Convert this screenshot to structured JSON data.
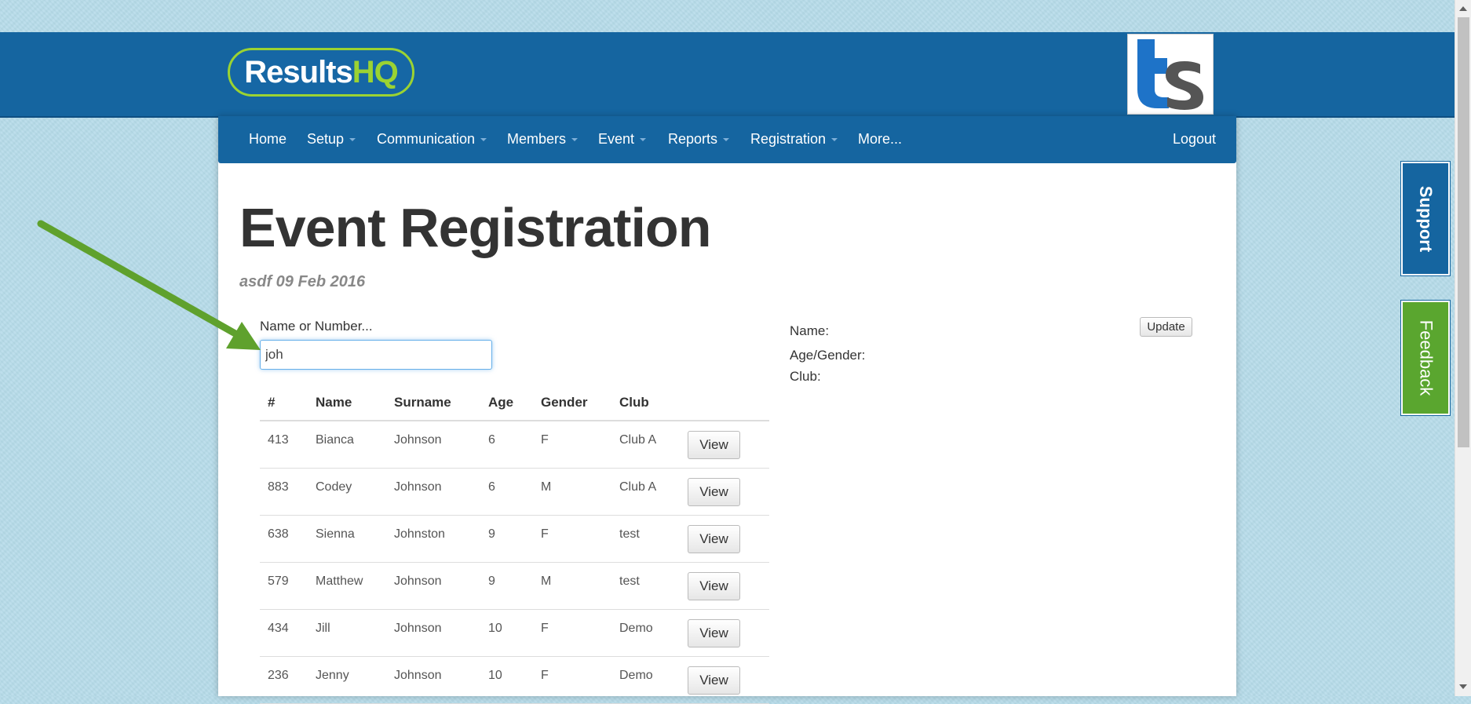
{
  "header": {
    "logo_main": "Results",
    "logo_accent": "HQ",
    "brand_color": "#1565a0",
    "accent_color": "#9bd332"
  },
  "nav": {
    "home": "Home",
    "setup": "Setup",
    "communication": "Communication",
    "members": "Members",
    "event": "Event",
    "reports": "Reports",
    "registration": "Registration",
    "more": "More...",
    "logout": "Logout"
  },
  "page": {
    "title": "Event Registration",
    "subtitle": "asdf 09 Feb 2016"
  },
  "search": {
    "label": "Name or Number...",
    "value": "joh"
  },
  "table": {
    "headers": [
      "#",
      "Name",
      "Surname",
      "Age",
      "Gender",
      "Club"
    ],
    "view_label": "View",
    "rows": [
      [
        "413",
        "Bianca",
        "Johnson",
        "6",
        "F",
        "Club A"
      ],
      [
        "883",
        "Codey",
        "Johnson",
        "6",
        "M",
        "Club A"
      ],
      [
        "638",
        "Sienna",
        "Johnston",
        "9",
        "F",
        "test"
      ],
      [
        "579",
        "Matthew",
        "Johnson",
        "9",
        "M",
        "test"
      ],
      [
        "434",
        "Jill",
        "Johnson",
        "10",
        "F",
        "Demo"
      ],
      [
        "236",
        "Jenny",
        "Johnson",
        "10",
        "F",
        "Demo"
      ]
    ]
  },
  "details": {
    "name_label": "Name:",
    "age_gender_label": "Age/Gender:",
    "club_label": "Club:",
    "update_label": "Update"
  },
  "side_tabs": {
    "support": "Support",
    "feedback": "Feedback",
    "feedback_color": "#5aa62f"
  },
  "annotation": {
    "arrow_color": "#5fa12d"
  }
}
